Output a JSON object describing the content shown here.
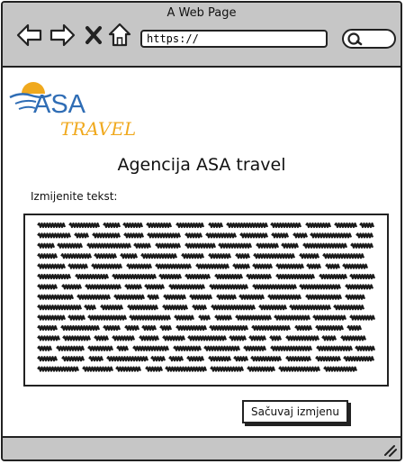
{
  "window": {
    "title": "A Web Page"
  },
  "browser": {
    "url": "https://",
    "nav_icons": [
      "back-arrow-icon",
      "forward-arrow-icon",
      "close-x-icon",
      "home-icon"
    ],
    "search_icon": "search-icon"
  },
  "logo": {
    "line1": "ASA",
    "line2": "TRAVEL"
  },
  "page": {
    "heading": "Agencija ASA travel",
    "edit_label": "Izmijenite tekst:",
    "save_label": "Sačuvaj izmjenu"
  },
  "colors": {
    "logo_blue": "#2f6db5",
    "logo_orange": "#f0a91e",
    "chrome": "#c6c6c6"
  }
}
